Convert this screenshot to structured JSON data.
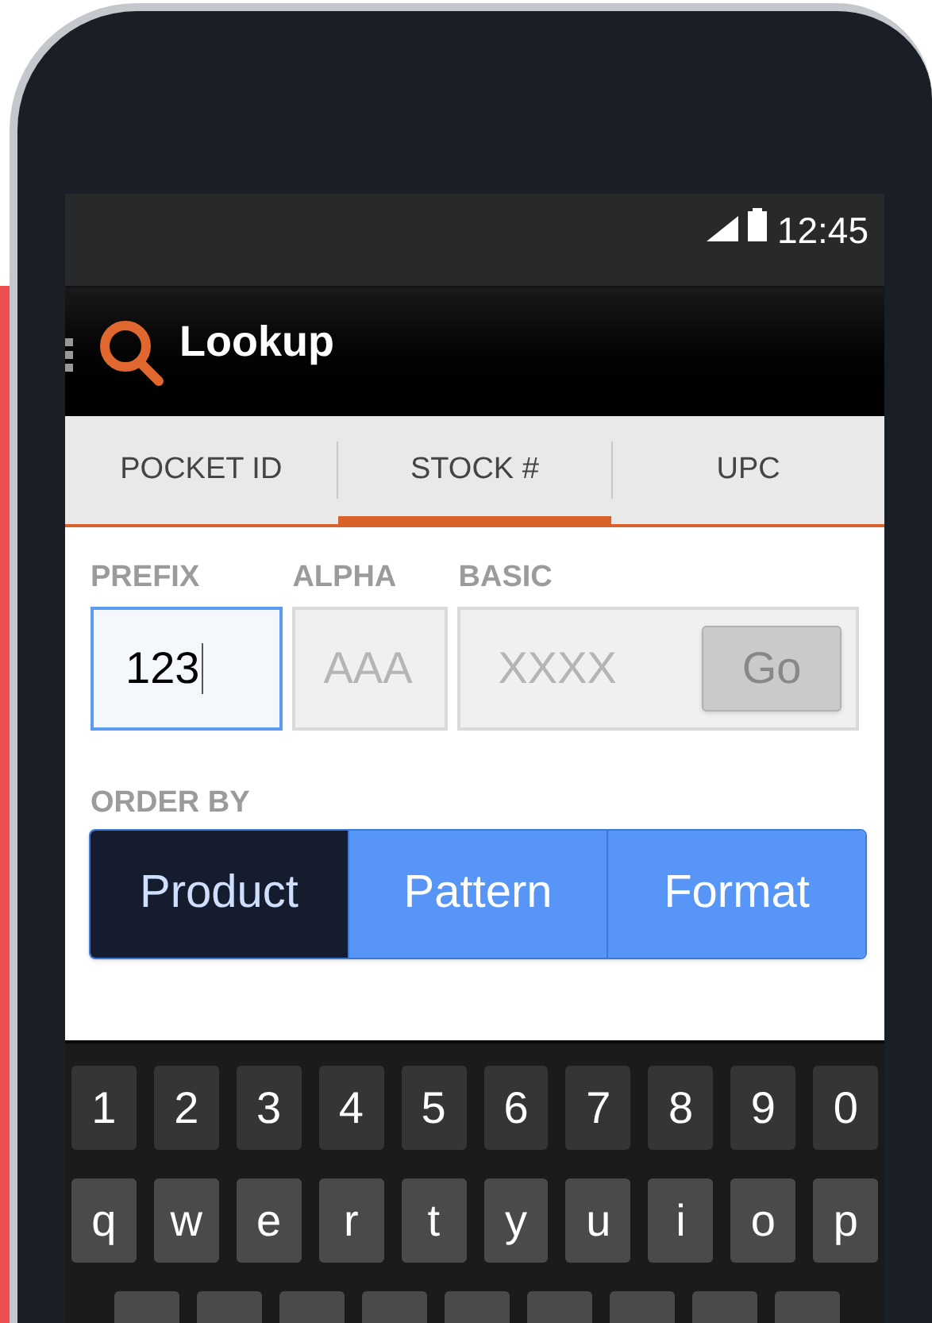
{
  "status_bar": {
    "time": "12:45"
  },
  "action_bar": {
    "title": "Lookup"
  },
  "tabs": [
    {
      "label": "POCKET ID",
      "selected": false
    },
    {
      "label": "STOCK #",
      "selected": true
    },
    {
      "label": "UPC",
      "selected": false
    }
  ],
  "fields": [
    {
      "label": "PREFIX",
      "value": "123",
      "focused": true
    },
    {
      "label": "ALPHA",
      "placeholder": "AAA",
      "focused": false
    },
    {
      "label": "BASIC",
      "placeholder": "XXXX",
      "focused": false,
      "button": "Go"
    }
  ],
  "order_by": {
    "label": "ORDER BY",
    "options": [
      {
        "label": "Product",
        "selected": true
      },
      {
        "label": "Pattern",
        "selected": false
      },
      {
        "label": "Format",
        "selected": false
      }
    ]
  },
  "keyboard": {
    "rows": [
      [
        "1",
        "2",
        "3",
        "4",
        "5",
        "6",
        "7",
        "8",
        "9",
        "0"
      ],
      [
        "q",
        "w",
        "e",
        "r",
        "t",
        "y",
        "u",
        "i",
        "o",
        "p"
      ]
    ]
  }
}
